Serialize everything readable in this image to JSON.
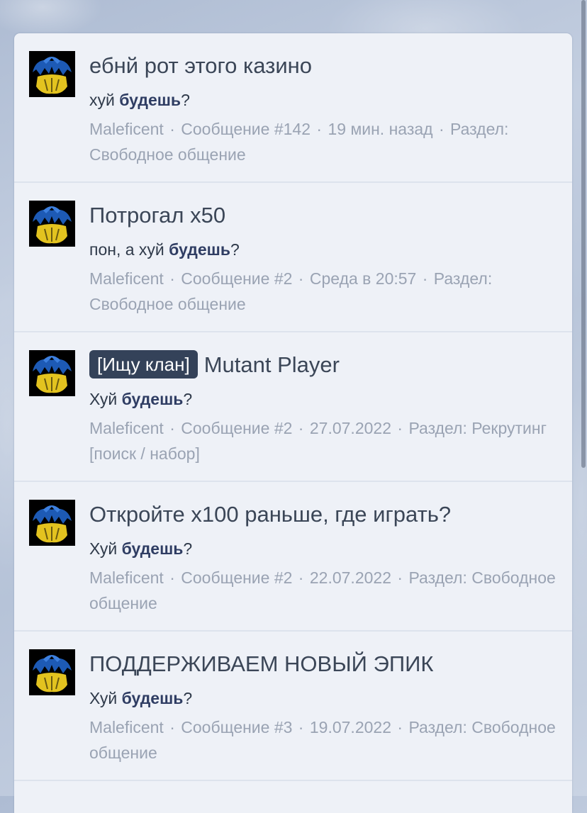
{
  "results": [
    {
      "title": "ебнй рот этого казино",
      "tag": "",
      "snippet_before": "хуй ",
      "snippet_highlight": "будешь",
      "snippet_after": "?",
      "author": "Maleficent",
      "post": "Сообщение #142",
      "time": "19 мин. назад",
      "section_label": "Раздел:",
      "section": "Свободное общение"
    },
    {
      "title": "Потрогал x50",
      "tag": "",
      "snippet_before": "пон, а хуй ",
      "snippet_highlight": "будешь",
      "snippet_after": "?",
      "author": "Maleficent",
      "post": "Сообщение #2",
      "time": "Среда в 20:57",
      "section_label": "Раздел:",
      "section": "Свободное общение"
    },
    {
      "title": "Mutant Player",
      "tag": "[Ищу клан]",
      "snippet_before": "Хуй ",
      "snippet_highlight": "будешь",
      "snippet_after": "?",
      "author": "Maleficent",
      "post": "Сообщение #2",
      "time": "27.07.2022",
      "section_label": "Раздел:",
      "section": "Рекрутинг [поиск / набор]"
    },
    {
      "title": "Откройте x100 раньше, где играть?",
      "tag": "",
      "snippet_before": "Хуй ",
      "snippet_highlight": "будешь",
      "snippet_after": "?",
      "author": "Maleficent",
      "post": "Сообщение #2",
      "time": "22.07.2022",
      "section_label": "Раздел:",
      "section": "Свободное общение"
    },
    {
      "title": "ПОДДЕРЖИВАЕМ НОВЫЙ ЭПИК",
      "tag": "",
      "snippet_before": "Хуй ",
      "snippet_highlight": "будешь",
      "snippet_after": "?",
      "author": "Maleficent",
      "post": "Сообщение #3",
      "time": "19.07.2022",
      "section_label": "Раздел:",
      "section": "Свободное общение"
    }
  ],
  "avatar_icon": "ukraine-flag-eagle-avatar-icon",
  "colors": {
    "panel_bg": "#eef1f7",
    "tag_bg": "#344259",
    "highlight": "#2f3d63",
    "meta": "#9aa3b3"
  }
}
